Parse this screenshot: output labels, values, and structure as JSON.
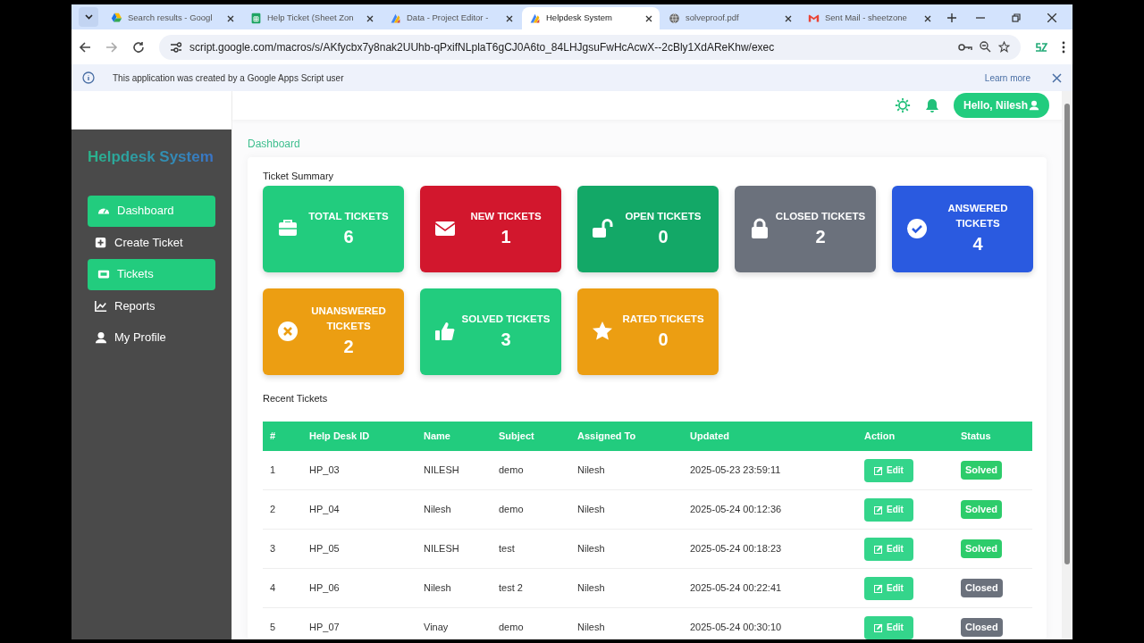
{
  "browser": {
    "tabs": [
      {
        "title": "Search results - Googl",
        "selected": false
      },
      {
        "title": "Help Ticket (Sheet Zon",
        "selected": false
      },
      {
        "title": "Data - Project Editor -",
        "selected": false
      },
      {
        "title": "Helpdesk System",
        "selected": true
      },
      {
        "title": "solveproof.pdf",
        "selected": false
      },
      {
        "title": "Sent Mail - sheetzone",
        "selected": false
      }
    ],
    "url": "script.google.com/macros/s/AKfycbx7y8nak2UUhb-qPxifNLplaT6gCJ0A6to_84LHJgsuFwHcAcwX--2cBly1XdAReKhw/exec",
    "info_text": "This application was created by a Google Apps Script user",
    "info_link": "Learn more"
  },
  "app": {
    "brand": "Helpdesk System",
    "nav": [
      {
        "label": "Dashboard",
        "selected": true
      },
      {
        "label": "Create Ticket",
        "selected": false
      },
      {
        "label": "Tickets",
        "selected": true
      },
      {
        "label": "Reports",
        "selected": false
      },
      {
        "label": "My Profile",
        "selected": false
      }
    ],
    "greeting": "Hello, Nilesh",
    "breadcrumb": "Dashboard",
    "summary_title": "Ticket Summary",
    "cards": [
      {
        "label": "TOTAL TICKETS",
        "value": "6",
        "color": "#22cc7e"
      },
      {
        "label": "NEW TICKETS",
        "value": "1",
        "color": "#d2172d"
      },
      {
        "label": "OPEN TICKETS",
        "value": "0",
        "color": "#13a867"
      },
      {
        "label": "CLOSED TICKETS",
        "value": "2",
        "color": "#6b717c"
      },
      {
        "label": "ANSWERED TICKETS",
        "value": "4",
        "color": "#2a5ae0"
      },
      {
        "label": "UNANSWERED TICKETS",
        "value": "2",
        "color": "#ec9e12"
      },
      {
        "label": "SOLVED TICKETS",
        "value": "3",
        "color": "#22cc7e"
      },
      {
        "label": "RATED TICKETS",
        "value": "0",
        "color": "#ec9e12"
      }
    ],
    "recent_title": "Recent Tickets",
    "table": {
      "columns": [
        "#",
        "Help Desk ID",
        "Name",
        "Subject",
        "Assigned To",
        "Updated",
        "Action",
        "Status"
      ],
      "rows": [
        {
          "cells": [
            "1",
            "HP_03",
            "NILESH",
            "demo",
            "Nilesh",
            "2025-05-23 23:59:11"
          ],
          "action": "Edit",
          "status": "Solved",
          "color": "#2dcc6b"
        },
        {
          "cells": [
            "2",
            "HP_04",
            "Nilesh",
            "demo",
            "Nilesh",
            "2025-05-24 00:12:36"
          ],
          "action": "Edit",
          "status": "Solved",
          "color": "#2dcc6b"
        },
        {
          "cells": [
            "3",
            "HP_05",
            "NILESH",
            "test",
            "Nilesh",
            "2025-05-24 00:18:23"
          ],
          "action": "Edit",
          "status": "Solved",
          "color": "#2dcc6b"
        },
        {
          "cells": [
            "4",
            "HP_06",
            "Nilesh",
            "test 2",
            "Nilesh",
            "2025-05-24 00:22:41"
          ],
          "action": "Edit",
          "status": "Closed",
          "color": "#6b717c"
        },
        {
          "cells": [
            "5",
            "HP_07",
            "Vinay",
            "demo",
            "Nilesh",
            "2025-05-24 00:30:10"
          ],
          "action": "Edit",
          "status": "Closed",
          "color": "#6b717c"
        }
      ]
    }
  }
}
